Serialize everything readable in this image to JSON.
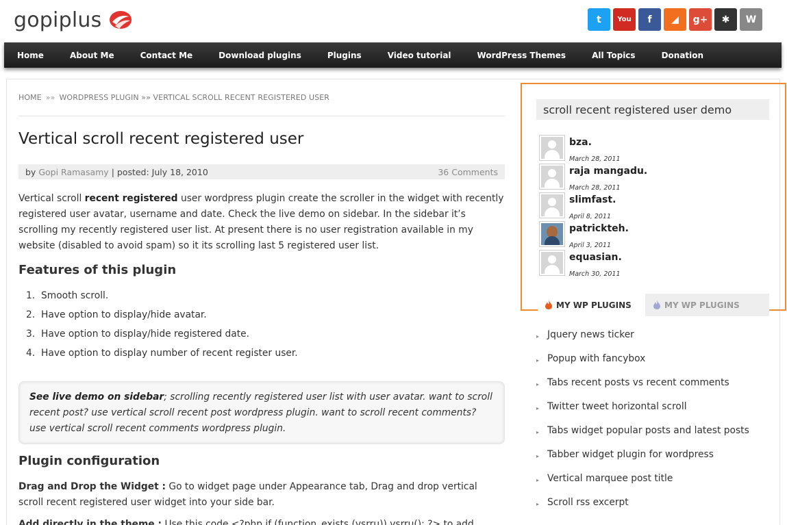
{
  "header": {
    "logo_text": "gopiplus",
    "social": [
      {
        "name": "twitter",
        "glyph": "t",
        "color": "#1da1f2"
      },
      {
        "name": "youtube",
        "glyph": "You",
        "color": "#d12a22"
      },
      {
        "name": "facebook",
        "glyph": "f",
        "color": "#3b5998"
      },
      {
        "name": "rss",
        "glyph": "◢",
        "color": "#f26f20"
      },
      {
        "name": "google-plus",
        "glyph": "g+",
        "color": "#dd4b39"
      },
      {
        "name": "joomla",
        "glyph": "✱",
        "color": "#333333"
      },
      {
        "name": "wordpress",
        "glyph": "W",
        "color": "#888888"
      }
    ]
  },
  "nav": {
    "items": [
      "Home",
      "About Me",
      "Contact Me",
      "Download plugins",
      "Plugins",
      "Video tutorial",
      "WordPress Themes",
      "All Topics",
      "Donation"
    ]
  },
  "breadcrumb": {
    "home": "HOME",
    "sep1": "»»",
    "section": "WORDPRESS PLUGIN",
    "current": "»» VERTICAL SCROLL RECENT REGISTERED USER"
  },
  "post": {
    "title": "Vertical scroll recent registered user",
    "by": "by",
    "author": "Gopi Ramasamy",
    "posted": "| posted: July 18, 2010",
    "comments": "36 Comments",
    "intro_pre": "Vertical scroll ",
    "intro_bold": "recent registered",
    "intro_post": " user wordpress plugin create the scroller in the widget with recently registered user avatar, username and date. Check the live demo on sidebar. In the sidebar it’s scrolling my recently registered user list. At present there is no user registration available in my website (disabled to avoid spam) so it its scrolling last 5 registered user list.",
    "features_heading": "Features of this plugin",
    "features": [
      {
        "num": "1.",
        "text": "Smooth scroll."
      },
      {
        "num": "2.",
        "text": "Have option to display/hide avatar."
      },
      {
        "num": "3.",
        "text": "Have option to display/hide registered date."
      },
      {
        "num": "4.",
        "text": "Have option to display number of recent register user."
      }
    ],
    "quote_bold": "See live demo on sidebar",
    "quote_text": "; scrolling recently registered user list with user avatar. want to scroll recent post? use vertical scroll recent post wordpress plugin. want to scroll recent comments? use vertical scroll recent comments wordpress plugin.",
    "config_heading": "Plugin configuration",
    "config_bold": "Drag and Drop the Widget :",
    "config_text": " Go to widget page under Appearance tab, Drag and drop vertical scroll recent registered user widget into your side bar.",
    "config2_bold": "Add directly in the theme :",
    "config2_text": " Use this code  <?php if (function_exists (vsrru)) vsrru(); ?> to add"
  },
  "sidebar": {
    "widget_title": "scroll recent registered user demo",
    "users": [
      {
        "name": "bza.",
        "date": "March 28, 2011",
        "photo": false
      },
      {
        "name": "raja mangadu.",
        "date": "March 28, 2011",
        "photo": false
      },
      {
        "name": "slimfast.",
        "date": "April 8, 2011",
        "photo": false
      },
      {
        "name": "patrickteh.",
        "date": "April 3, 2011",
        "photo": true
      },
      {
        "name": "equasian.",
        "date": "March 30, 2011",
        "photo": false
      }
    ],
    "tabs": [
      "MY WP PLUGINS",
      "MY WP PLUGINS"
    ],
    "plugins": [
      "Jquery news ticker",
      "Popup with fancybox",
      "Tabs recent posts vs recent comments",
      "Twitter tweet horizontal scroll",
      "Tabs widget popular posts and latest posts",
      "Tabber widget plugin for wordpress",
      "Vertical marquee post title",
      "Scroll rss excerpt"
    ]
  },
  "colors": {
    "accent": "#f08a2e",
    "nav_bg": "#2a2a2a"
  }
}
